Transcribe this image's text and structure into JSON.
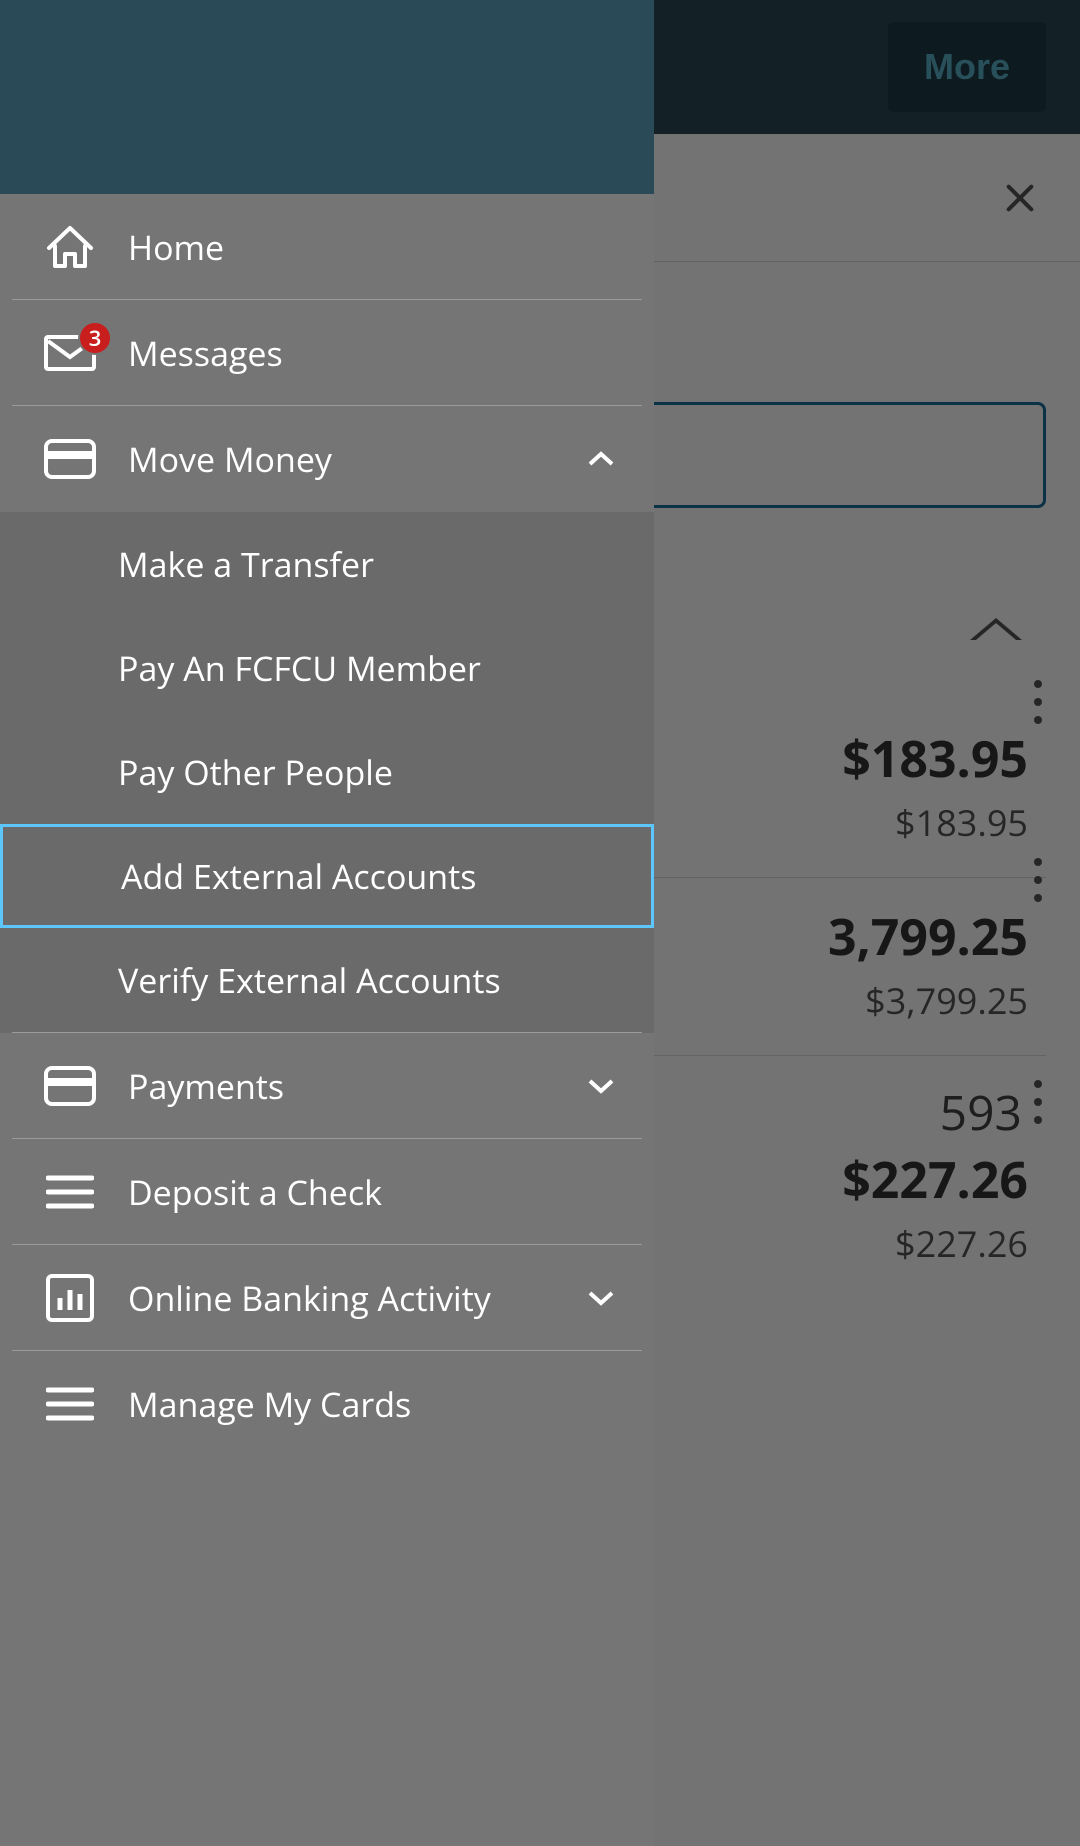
{
  "header": {
    "more_label": "More"
  },
  "nav": {
    "home": "Home",
    "messages": "Messages",
    "messages_badge": "3",
    "move_money": "Move Money",
    "move_money_items": {
      "make_transfer": "Make a Transfer",
      "pay_member": "Pay An FCFCU Member",
      "pay_other": "Pay Other People",
      "add_external": "Add External Accounts",
      "verify_external": "Verify External Accounts"
    },
    "payments": "Payments",
    "deposit_check": "Deposit a Check",
    "online_activity": "Online Banking Activity",
    "manage_cards": "Manage My Cards"
  },
  "bg": {
    "accounts": [
      {
        "amount": "$183.95",
        "sub": "$183.95"
      },
      {
        "amount": "3,799.25",
        "sub": "$3,799.25"
      },
      {
        "num_fragment": "593",
        "amount": "$227.26",
        "sub": "$227.26"
      }
    ]
  }
}
